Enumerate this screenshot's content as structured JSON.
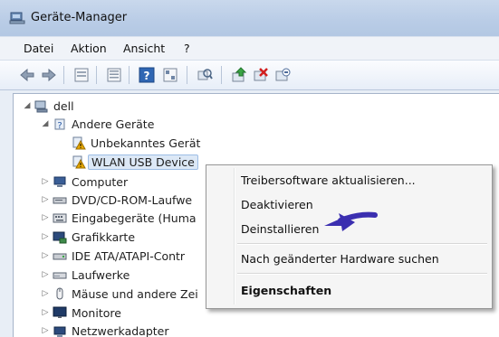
{
  "window": {
    "title": "Geräte-Manager"
  },
  "menu": [
    "Datei",
    "Aktion",
    "Ansicht",
    "?"
  ],
  "toolbar": {
    "buttons": [
      "back-arrow-icon",
      "forward-arrow-icon",
      "properties-view-icon",
      "list-view-icon",
      "help-icon",
      "device-view-icon",
      "scan-hardware-icon",
      "update-driver-icon",
      "uninstall-device-icon",
      "disable-device-icon"
    ]
  },
  "tree": {
    "root": "dell",
    "items": [
      {
        "label": "Andere Geräte",
        "level": 1,
        "expanded": true
      },
      {
        "label": "Unbekanntes Gerät",
        "level": 2
      },
      {
        "label": "WLAN USB Device",
        "level": 2,
        "selected": true
      },
      {
        "label": "Computer",
        "level": 1
      },
      {
        "label": "DVD/CD-ROM-Laufwe",
        "level": 1
      },
      {
        "label": "Eingabegeräte (Huma",
        "level": 1
      },
      {
        "label": "Grafikkarte",
        "level": 1
      },
      {
        "label": "IDE ATA/ATAPI-Contr",
        "level": 1
      },
      {
        "label": "Laufwerke",
        "level": 1
      },
      {
        "label": "Mäuse und andere Zei",
        "level": 1
      },
      {
        "label": "Monitore",
        "level": 1
      },
      {
        "label": "Netzwerkadapter",
        "level": 1
      }
    ]
  },
  "context_menu": {
    "items": [
      {
        "label": "Treibersoftware aktualisieren..."
      },
      {
        "label": "Deaktivieren"
      },
      {
        "label": "Deinstallieren"
      },
      {
        "label": "Nach geänderter Hardware suchen"
      },
      {
        "label": "Eigenschaften",
        "bold": true
      }
    ]
  },
  "colors": {
    "annotation_arrow": "#3b2fb0",
    "warning_icon": "#e8a800"
  }
}
